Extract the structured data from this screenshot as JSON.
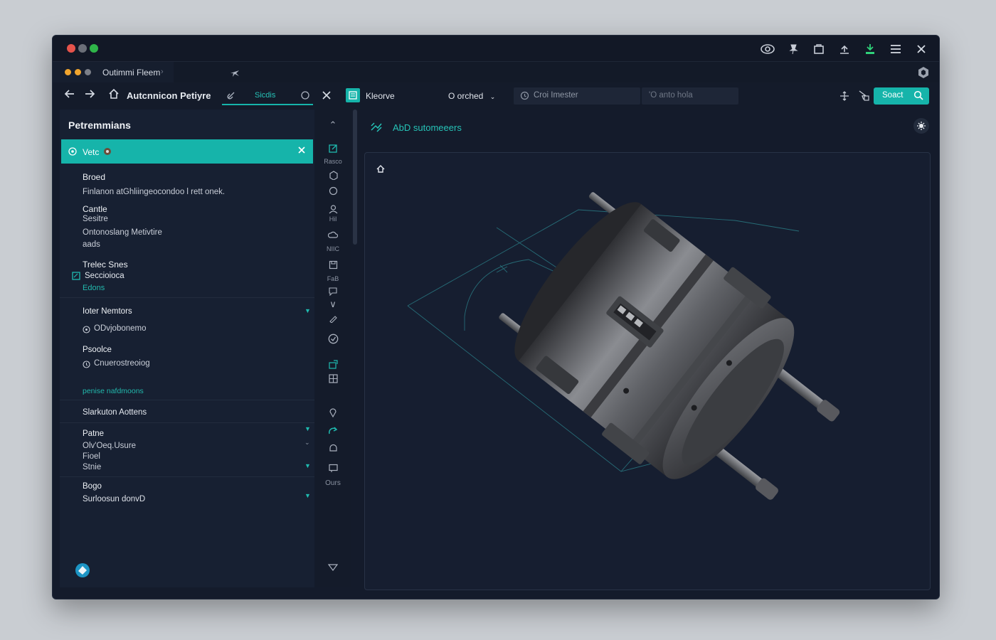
{
  "window": {
    "traffic_lights": [
      "#e5534b",
      "#6b6f78",
      "#2fb549"
    ],
    "titlebar_icons": [
      "eye-icon",
      "pin-icon",
      "window-icon",
      "upload-icon",
      "download-icon",
      "menu-icon",
      "close-icon"
    ]
  },
  "tab": {
    "title": "Outimmi Fleem",
    "dots": [
      "#f1a52e",
      "#f1a52e",
      "#7b7f88"
    ],
    "chevron": "›"
  },
  "toolbar": {
    "app_title": "Autcnnicon Petiyre",
    "search_label": "Sicdis"
  },
  "right_toolbar": {
    "doc_label": "Kleorve",
    "dropdown_label": "O orched",
    "filter_placeholder": "Croi Imester",
    "filter2_placeholder": "'O anto hola",
    "primary_button": "Soact"
  },
  "sidebar": {
    "title": "Petremmians",
    "active_item": "Vetc",
    "sections": [
      {
        "heading": "Broed",
        "text": "Finlanon atGhliingeocondoo l rett onek."
      },
      {
        "heading": "Cantle",
        "lines": [
          "Sesitre",
          "Ontonoslang Metivtire",
          "aads"
        ]
      },
      {
        "heading": "Trelec Snes",
        "lines": [
          "Seccioioca"
        ],
        "link": "Edons"
      },
      {
        "heading": "Ioter Nemtors",
        "lines": [
          "ODvjobonemo"
        ]
      },
      {
        "heading": "Psoolce",
        "lines": [
          "Cnuerostreoiog"
        ]
      },
      {
        "link": "penise nafdmoons"
      },
      {
        "heading": "Slarkuton Aottens"
      },
      {
        "heading": "Patne",
        "lines": [
          "Olv'Oeq.Usure",
          "Fioel",
          "Stnie"
        ]
      },
      {
        "heading": "Bogo",
        "lines": [
          "Surloosun donvD"
        ]
      }
    ]
  },
  "rail": {
    "labels": [
      "Rasco",
      "Hil",
      "NIIC",
      "FaB",
      "Ours"
    ]
  },
  "main": {
    "title": "AbD sutomeeers"
  },
  "accent_color": "#16b4aa"
}
